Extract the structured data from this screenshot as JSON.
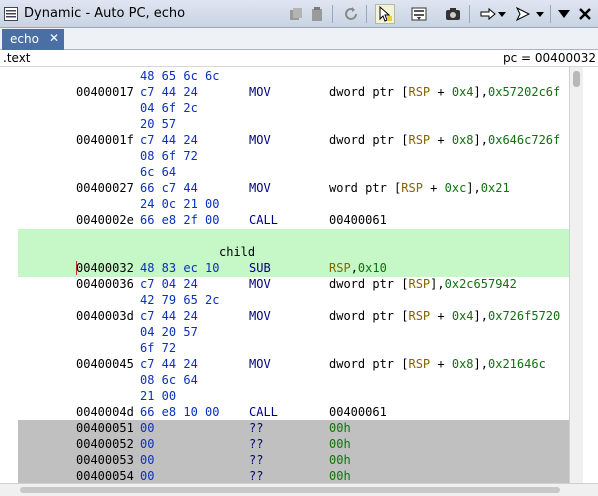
{
  "window": {
    "title": "Dynamic - Auto PC, echo"
  },
  "toolbar": {
    "icons": [
      "copy-icon",
      "paste-icon",
      "refresh-icon",
      "cursor-track-icon",
      "listing-options-icon",
      "snapshot-icon",
      "goto-arrow-icon",
      "dropdown-icon",
      "step-icon",
      "dropdown-icon",
      "menu-icon",
      "close-icon"
    ]
  },
  "tab": {
    "label": "echo",
    "close": "✕"
  },
  "header": {
    "section": ".text",
    "pc": "pc = 00400032"
  },
  "listing": {
    "rows": [
      {
        "addr": "",
        "bytes": "48 65 6c 6c",
        "mn": "",
        "op": ""
      },
      {
        "addr": "00400017",
        "bytes": "c7 44 24",
        "mn": "MOV",
        "op_parts": [
          [
            "dword ptr [",
            ""
          ],
          [
            "RSP",
            "reg"
          ],
          [
            " + ",
            ""
          ],
          [
            "0x4",
            "num"
          ],
          [
            "],",
            ""
          ],
          [
            "0x57202c6f",
            "num"
          ]
        ]
      },
      {
        "addr": "",
        "bytes": "04 6f 2c",
        "mn": "",
        "op": ""
      },
      {
        "addr": "",
        "bytes": "20 57",
        "mn": "",
        "op": ""
      },
      {
        "addr": "0040001f",
        "bytes": "c7 44 24",
        "mn": "MOV",
        "op_parts": [
          [
            "dword ptr [",
            ""
          ],
          [
            "RSP",
            "reg"
          ],
          [
            " + ",
            ""
          ],
          [
            "0x8",
            "num"
          ],
          [
            "],",
            ""
          ],
          [
            "0x646c726f",
            "num"
          ]
        ]
      },
      {
        "addr": "",
        "bytes": "08 6f 72",
        "mn": "",
        "op": ""
      },
      {
        "addr": "",
        "bytes": "6c 64",
        "mn": "",
        "op": ""
      },
      {
        "addr": "00400027",
        "bytes": "66 c7 44",
        "mn": "MOV",
        "op_parts": [
          [
            "word ptr [",
            ""
          ],
          [
            "RSP",
            "reg"
          ],
          [
            " + ",
            ""
          ],
          [
            "0xc",
            "num"
          ],
          [
            "],",
            ""
          ],
          [
            "0x21",
            "num"
          ]
        ]
      },
      {
        "addr": "",
        "bytes": "24 0c 21 00",
        "mn": "",
        "op": ""
      },
      {
        "addr": "0040002e",
        "bytes": "66 e8 2f 00",
        "mn": "CALL",
        "op_parts": [
          [
            "00400061",
            ""
          ]
        ]
      }
    ],
    "label": "child",
    "rows2": [
      {
        "addr": "00400032",
        "bytes": "48 83 ec 10",
        "mn": "SUB",
        "op_parts": [
          [
            "RSP",
            "reg"
          ],
          [
            ",",
            ""
          ],
          [
            "0x10",
            "num"
          ]
        ]
      },
      {
        "addr": "00400036",
        "bytes": "c7 04 24",
        "mn": "MOV",
        "op_parts": [
          [
            "dword ptr [",
            ""
          ],
          [
            "RSP",
            "reg"
          ],
          [
            "],",
            ""
          ],
          [
            "0x2c657942",
            "num"
          ]
        ]
      },
      {
        "addr": "",
        "bytes": "42 79 65 2c",
        "mn": "",
        "op": ""
      },
      {
        "addr": "0040003d",
        "bytes": "c7 44 24",
        "mn": "MOV",
        "op_parts": [
          [
            "dword ptr [",
            ""
          ],
          [
            "RSP",
            "reg"
          ],
          [
            " + ",
            ""
          ],
          [
            "0x4",
            "num"
          ],
          [
            "],",
            ""
          ],
          [
            "0x726f5720",
            "num"
          ]
        ]
      },
      {
        "addr": "",
        "bytes": "04 20 57",
        "mn": "",
        "op": ""
      },
      {
        "addr": "",
        "bytes": "6f 72",
        "mn": "",
        "op": ""
      },
      {
        "addr": "00400045",
        "bytes": "c7 44 24",
        "mn": "MOV",
        "op_parts": [
          [
            "dword ptr [",
            ""
          ],
          [
            "RSP",
            "reg"
          ],
          [
            " + ",
            ""
          ],
          [
            "0x8",
            "num"
          ],
          [
            "],",
            ""
          ],
          [
            "0x21646c",
            "num"
          ]
        ]
      },
      {
        "addr": "",
        "bytes": "08 6c 64",
        "mn": "",
        "op": ""
      },
      {
        "addr": "",
        "bytes": "21 00",
        "mn": "",
        "op": ""
      },
      {
        "addr": "0040004d",
        "bytes": "66 e8 10 00",
        "mn": "CALL",
        "op_parts": [
          [
            "00400061",
            ""
          ]
        ]
      }
    ],
    "unknown_rows": [
      {
        "addr": "00400051",
        "bytes": "00",
        "mn": "??",
        "op": "00h"
      },
      {
        "addr": "00400052",
        "bytes": "00",
        "mn": "??",
        "op": "00h"
      },
      {
        "addr": "00400053",
        "bytes": "00",
        "mn": "??",
        "op": "00h"
      },
      {
        "addr": "00400054",
        "bytes": "00",
        "mn": "??",
        "op": "00h"
      }
    ]
  },
  "colors": {
    "tab_bg": "#4a6fa5",
    "pc_highlight": "#c6f7c6",
    "unknown_bg": "#c0c0c0",
    "bytes_color": "#0a2fbd",
    "register_color": "#806600",
    "scalar_color": "#107010"
  }
}
